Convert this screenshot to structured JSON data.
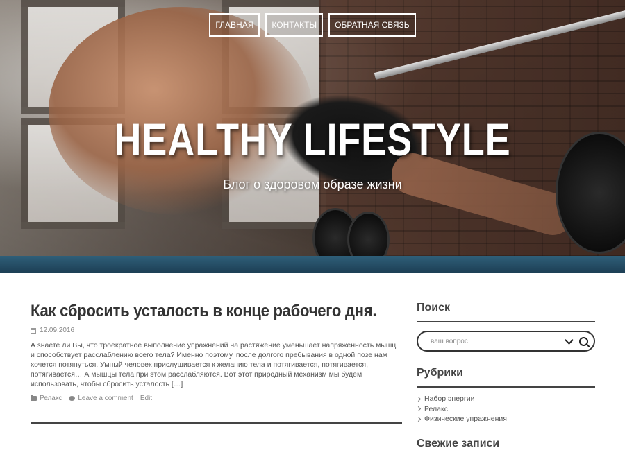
{
  "nav": {
    "items": [
      {
        "label": "ГЛАВНАЯ"
      },
      {
        "label": "КОНТАКТЫ"
      },
      {
        "label": "ОБРАТНАЯ СВЯЗЬ"
      }
    ]
  },
  "hero": {
    "title": "HEALTHY LIFESTYLE",
    "subtitle": "Блог о здоровом образе жизни"
  },
  "post": {
    "title": "Как сбросить усталость в конце рабочего дня.",
    "date": "12.09.2016",
    "date_icon": "calendar-icon",
    "excerpt": "А знаете ли Вы, что троекратное выполнение упражнений на растяжение уменьшает напряженность мышц и способствует расслаблению всего тела? Именно поэтому, после долгого пребывания в одной позе нам хочется потянуться. Умный человек прислушивается к желанию тела и потягивается, потягивается, потягивается… А мышцы тела при этом расслабляются. Вот этот природный механизм мы будем использовать, чтобы сбросить усталость […]",
    "category": "Релакс",
    "category_icon": "folder-icon",
    "comment_link": "Leave a comment",
    "comment_icon": "comment-icon",
    "edit_link": "Edit"
  },
  "sidebar": {
    "search": {
      "title": "Поиск",
      "placeholder": "ваш вопрос"
    },
    "rubrics": {
      "title": "Рубрики",
      "items": [
        "Набор энергии",
        "Релакс",
        "Физические упражнения"
      ]
    },
    "recent": {
      "title": "Свежие записи"
    }
  },
  "colors": {
    "text_dark": "#333333",
    "text_muted": "#888888",
    "divider": "#444444",
    "hero_text": "#ffffff"
  }
}
